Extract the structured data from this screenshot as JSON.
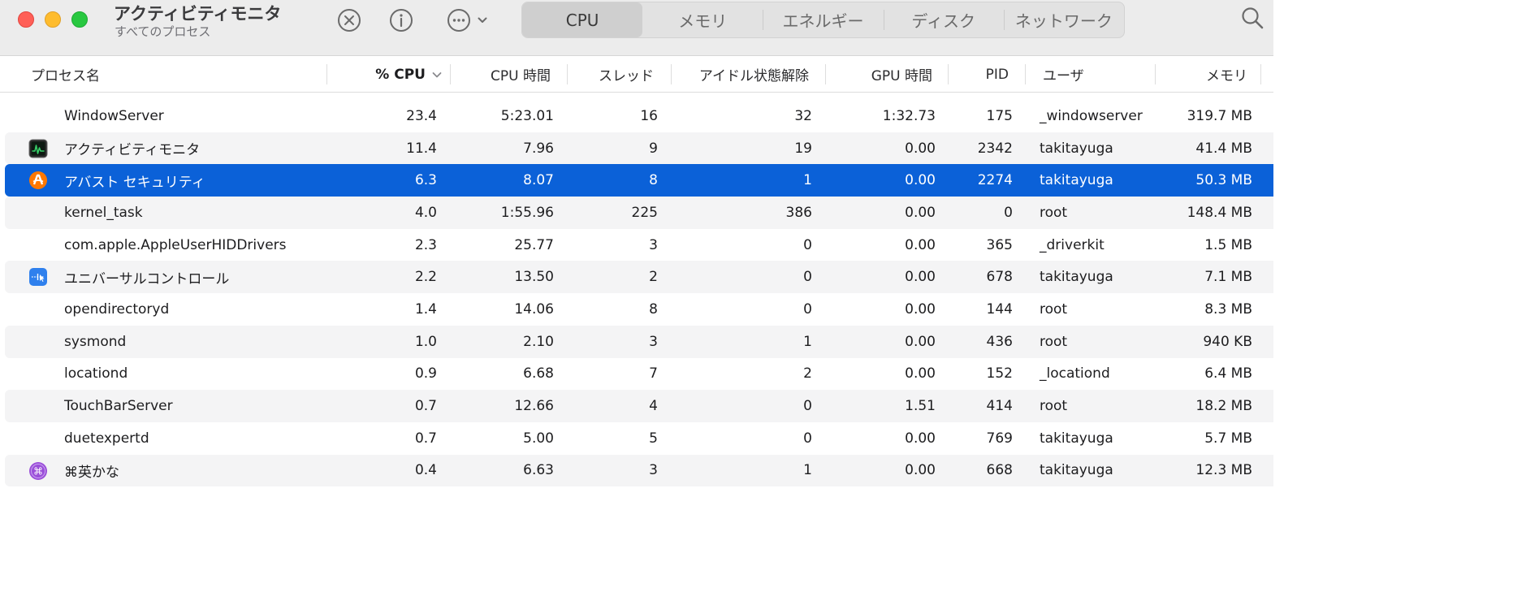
{
  "app": {
    "title": "アクティビティモニタ",
    "subtitle": "すべてのプロセス"
  },
  "toolbar": {
    "stop_icon": "stop-process-icon",
    "info_icon": "info-icon",
    "more_icon": "more-options-icon",
    "search_icon": "search-icon"
  },
  "tabs": [
    {
      "label": "CPU",
      "active": true
    },
    {
      "label": "メモリ",
      "active": false
    },
    {
      "label": "エネルギー",
      "active": false
    },
    {
      "label": "ディスク",
      "active": false
    },
    {
      "label": "ネットワーク",
      "active": false
    }
  ],
  "columns": {
    "name": "プロセス名",
    "cpu": "% CPU",
    "cpu_time": "CPU 時間",
    "threads": "スレッド",
    "idle_wakeups": "アイドル状態解除",
    "gpu_time": "GPU 時間",
    "pid": "PID",
    "user": "ユーザ",
    "memory": "メモリ"
  },
  "sort": {
    "column": "cpu",
    "direction": "descending"
  },
  "colors": {
    "selection": "#0b61d8",
    "row_alt": "#f4f4f5",
    "toolbar_bg": "#ececec",
    "close": "#ff5f57",
    "minimize": "#febc2e",
    "zoom": "#28c840"
  },
  "rows": [
    {
      "name": "WindowServer",
      "icon": "",
      "cpu": "23.4",
      "cpu_time": "5:23.01",
      "threads": "16",
      "idle_wakeups": "32",
      "gpu_time": "1:32.73",
      "pid": "175",
      "user": "_windowserver",
      "memory": "319.7 MB"
    },
    {
      "name": "アクティビティモニタ",
      "icon": "activity-monitor-icon",
      "cpu": "11.4",
      "cpu_time": "7.96",
      "threads": "9",
      "idle_wakeups": "19",
      "gpu_time": "0.00",
      "pid": "2342",
      "user": "takitayuga",
      "memory": "41.4 MB"
    },
    {
      "name": "アバスト セキュリティ",
      "icon": "avast-icon",
      "cpu": "6.3",
      "cpu_time": "8.07",
      "threads": "8",
      "idle_wakeups": "1",
      "gpu_time": "0.00",
      "pid": "2274",
      "user": "takitayuga",
      "memory": "50.3 MB",
      "selected": true
    },
    {
      "name": "kernel_task",
      "icon": "",
      "cpu": "4.0",
      "cpu_time": "1:55.96",
      "threads": "225",
      "idle_wakeups": "386",
      "gpu_time": "0.00",
      "pid": "0",
      "user": "root",
      "memory": "148.4 MB"
    },
    {
      "name": "com.apple.AppleUserHIDDrivers",
      "icon": "",
      "cpu": "2.3",
      "cpu_time": "25.77",
      "threads": "3",
      "idle_wakeups": "0",
      "gpu_time": "0.00",
      "pid": "365",
      "user": "_driverkit",
      "memory": "1.5 MB"
    },
    {
      "name": "ユニバーサルコントロール",
      "icon": "universal-control-icon",
      "cpu": "2.2",
      "cpu_time": "13.50",
      "threads": "2",
      "idle_wakeups": "0",
      "gpu_time": "0.00",
      "pid": "678",
      "user": "takitayuga",
      "memory": "7.1 MB"
    },
    {
      "name": "opendirectoryd",
      "icon": "",
      "cpu": "1.4",
      "cpu_time": "14.06",
      "threads": "8",
      "idle_wakeups": "0",
      "gpu_time": "0.00",
      "pid": "144",
      "user": "root",
      "memory": "8.3 MB"
    },
    {
      "name": "sysmond",
      "icon": "",
      "cpu": "1.0",
      "cpu_time": "2.10",
      "threads": "3",
      "idle_wakeups": "1",
      "gpu_time": "0.00",
      "pid": "436",
      "user": "root",
      "memory": "940 KB"
    },
    {
      "name": "locationd",
      "icon": "",
      "cpu": "0.9",
      "cpu_time": "6.68",
      "threads": "7",
      "idle_wakeups": "2",
      "gpu_time": "0.00",
      "pid": "152",
      "user": "_locationd",
      "memory": "6.4 MB"
    },
    {
      "name": "TouchBarServer",
      "icon": "",
      "cpu": "0.7",
      "cpu_time": "12.66",
      "threads": "4",
      "idle_wakeups": "0",
      "gpu_time": "1.51",
      "pid": "414",
      "user": "root",
      "memory": "18.2 MB"
    },
    {
      "name": "duetexpertd",
      "icon": "",
      "cpu": "0.7",
      "cpu_time": "5.00",
      "threads": "5",
      "idle_wakeups": "0",
      "gpu_time": "0.00",
      "pid": "769",
      "user": "takitayuga",
      "memory": "5.7 MB"
    },
    {
      "name": "⌘英かな",
      "icon": "eikana-icon",
      "cpu": "0.4",
      "cpu_time": "6.63",
      "threads": "3",
      "idle_wakeups": "1",
      "gpu_time": "0.00",
      "pid": "668",
      "user": "takitayuga",
      "memory": "12.3 MB"
    }
  ]
}
